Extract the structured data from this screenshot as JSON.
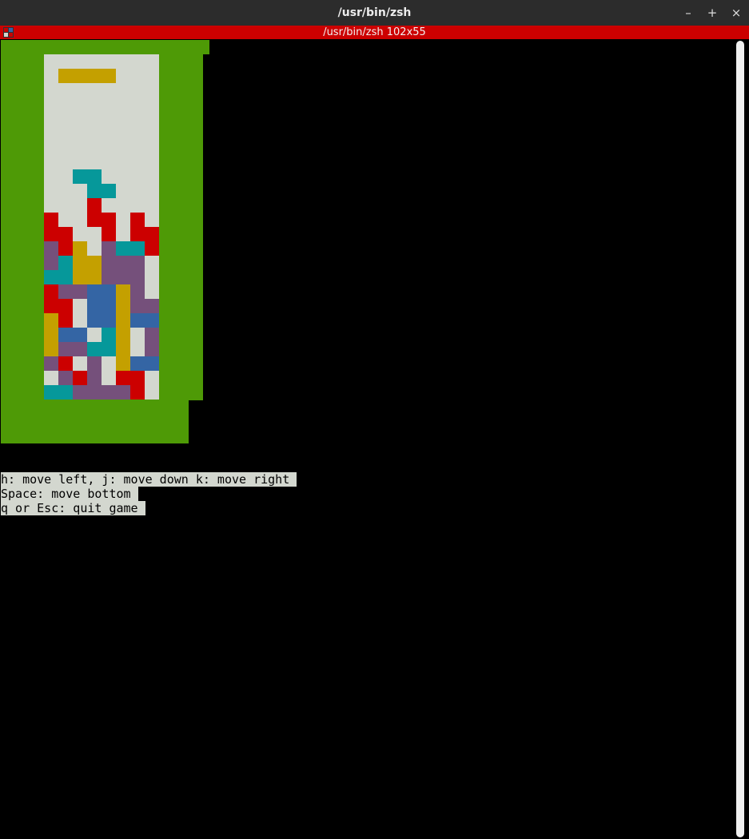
{
  "window": {
    "title": "/usr/bin/zsh",
    "minimize_label": "–",
    "maximize_label": "+",
    "close_label": "×"
  },
  "tab": {
    "title": "/usr/bin/zsh 102x55",
    "icon": "terminal-icon"
  },
  "colors": {
    "green": "#4e9a06",
    "gray": "#d3d7cf",
    "yellow": "#c4a000",
    "cyan": "#06989a",
    "red": "#cc0000",
    "purple": "#75507b",
    "blue": "#3465a4",
    "black": "#000000"
  },
  "board": {
    "rows": [
      "GGGGGGGGGGGGGG",
      "GGGWWWWWWWWGGG",
      "GGGWYYYYWWWGGG",
      "GGGWWWWWWWWGGG",
      "GGGWWWWWWWWGGG",
      "GGGWWWWWWWWGGG",
      "GGGWWWWWWWWGGG",
      "GGGWWWWWWWWGGG",
      "GGGWWWWWWWWGGG",
      "GGGWWCCWWWWGGG",
      "GGGWWWCCWWWGGG",
      "GGGWWWRWWWWGGG",
      "GGGRWWRRWRWGGG",
      "GGGRRWWRWRRGGG",
      "GGGPRYWPCCRGGG",
      "GGGPCYYPPPWGGG",
      "GGGCCYYPPPWGGG",
      "GGGRPPBBYPWGGG",
      "GGGRRWBBYPPGGG",
      "GGGYRWBBYBBGGG",
      "GGGYBBWCYWPGGG",
      "GGGYPPCCYWPGGG",
      "GGGPRWPWYBBGGG",
      "GGGWPRPWRRWGGG",
      "GGGCCPPPPRWGGG",
      "GGGGGGGGGGGGG.",
      "GGGGGGGGGGGGG.",
      "GGGGGGGGGGGGG."
    ]
  },
  "help": {
    "line1": "h: move left, j: move down k: move right",
    "line2": "Space: move bottom",
    "line3": "q or Esc: quit game"
  }
}
